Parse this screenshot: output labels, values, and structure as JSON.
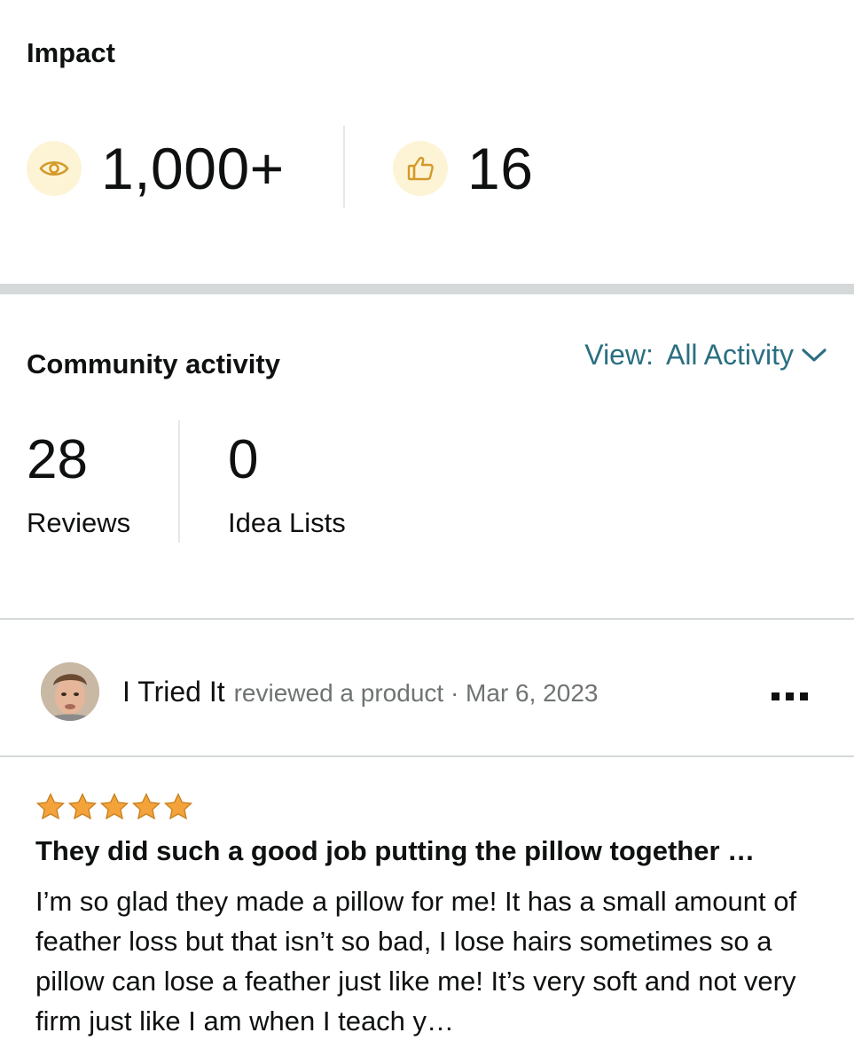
{
  "impact": {
    "title": "Impact",
    "views": {
      "icon": "eye-icon",
      "value": "1,000+"
    },
    "likes": {
      "icon": "thumbs-up-icon",
      "value": "16"
    },
    "icon_color": "#d49a2a",
    "icon_bg": "#fdf4d6"
  },
  "community": {
    "title": "Community activity",
    "view_prefix": "View:",
    "view_value": "All Activity",
    "reviews": {
      "count": "28",
      "label": "Reviews"
    },
    "idea_lists": {
      "count": "0",
      "label": "Idea Lists"
    }
  },
  "post": {
    "author": "I Tried It",
    "meta": "reviewed a product · Mar 6, 2023",
    "rating": 5,
    "star_color": "#f3a33a",
    "title": "They did such a good job putting the pillow together …",
    "body": "I’m so glad they made a pillow for me! It has a small amount of feather loss but that isn’t so bad, I lose hairs sometimes so a pillow can lose a feather just like me! It’s very soft and not very firm just like I am when I teach y…",
    "link_color": "#2a6f81"
  }
}
